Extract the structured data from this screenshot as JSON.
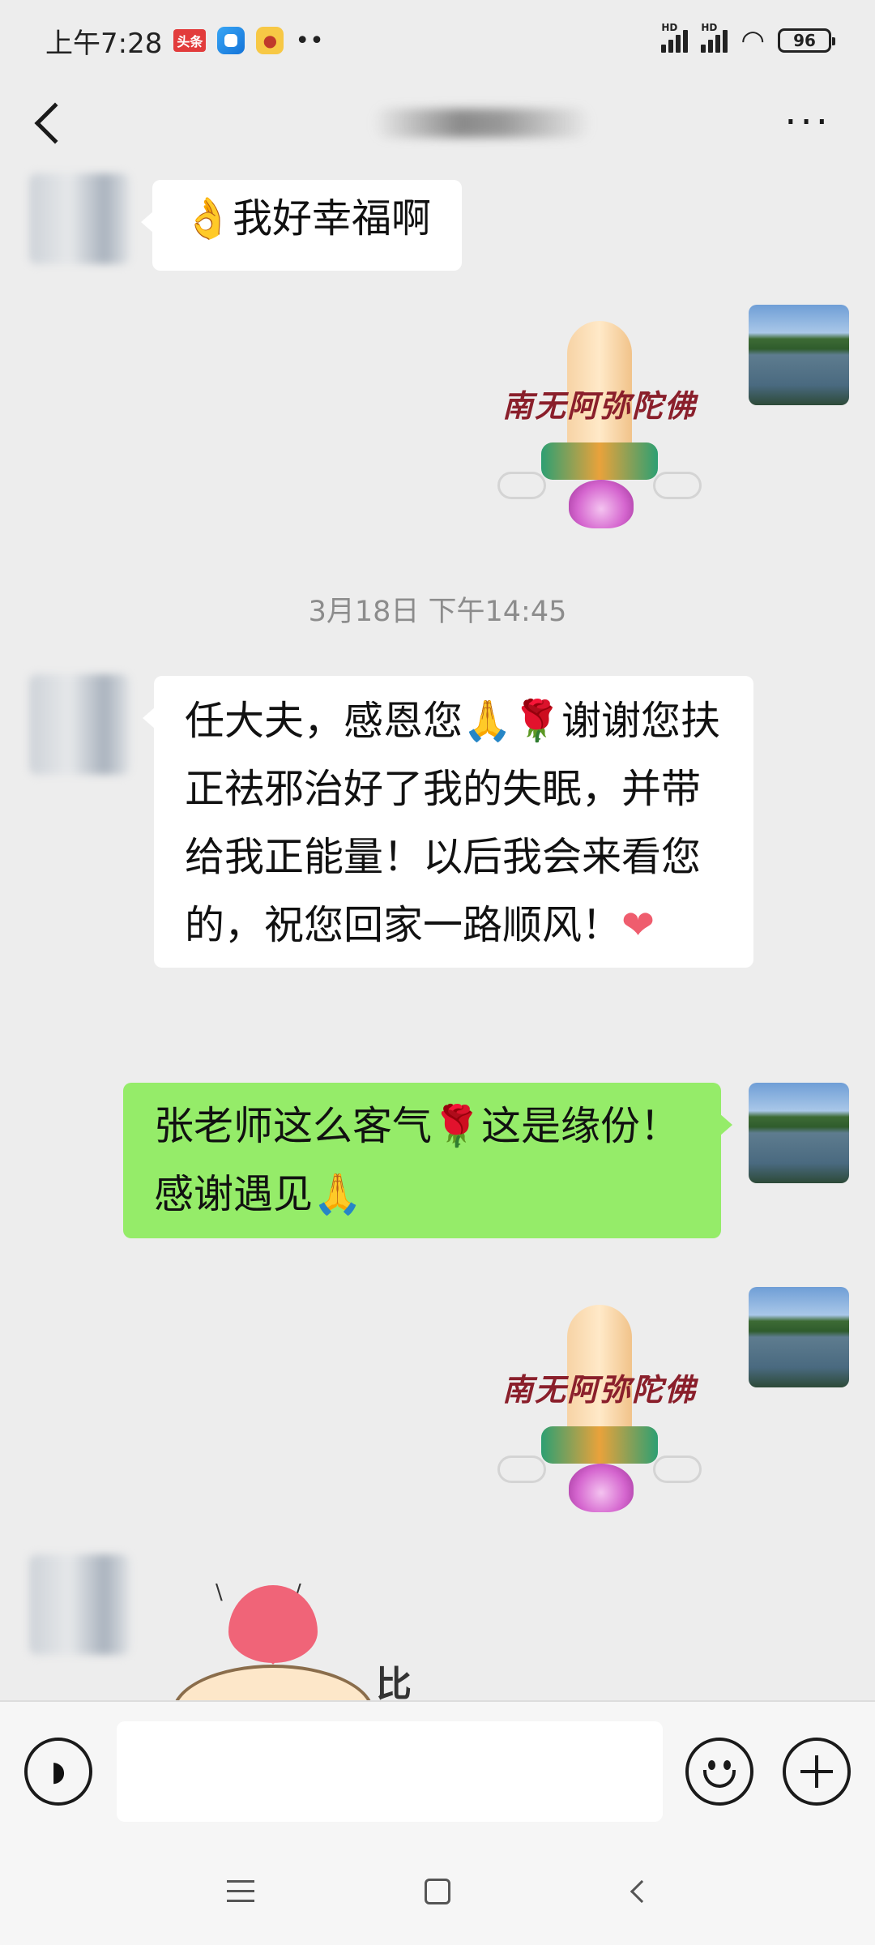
{
  "status_bar": {
    "time": "上午7:28",
    "app_badge": "头条",
    "battery": "96",
    "hd1": "HD",
    "hd2": "HD"
  },
  "header": {
    "more": "···"
  },
  "messages": [
    {
      "side": "left",
      "text_parts": [
        "👌",
        "我好幸福啊"
      ]
    },
    {
      "side": "right",
      "sticker_text": "南无阿弥陀佛"
    },
    {
      "side": "left",
      "text_parts": [
        "任大夫，感恩您",
        "🙏",
        "🌹",
        "谢谢您扶正祛邪治好了我的失眠，并带给我正能量！以后我会来看您的，祝您回家一路顺风！",
        "❤"
      ]
    },
    {
      "side": "right",
      "text_parts": [
        "张老师这么客气",
        "🌹",
        "这是缘份！感谢遇见",
        "🙏"
      ]
    },
    {
      "side": "right",
      "sticker_text": "南无阿弥陀佛"
    },
    {
      "side": "left",
      "sticker_text": "比"
    }
  ],
  "timestamp": "3月18日 下午14:45",
  "input": {
    "value": ""
  },
  "colors": {
    "background": "#ededed",
    "self_bubble": "#95ec69",
    "other_bubble": "#ffffff"
  },
  "icons": [
    "back-icon",
    "more-icon",
    "voice-icon",
    "emoji-icon",
    "plus-icon",
    "nav-menu-icon",
    "nav-home-icon",
    "nav-back-icon"
  ]
}
